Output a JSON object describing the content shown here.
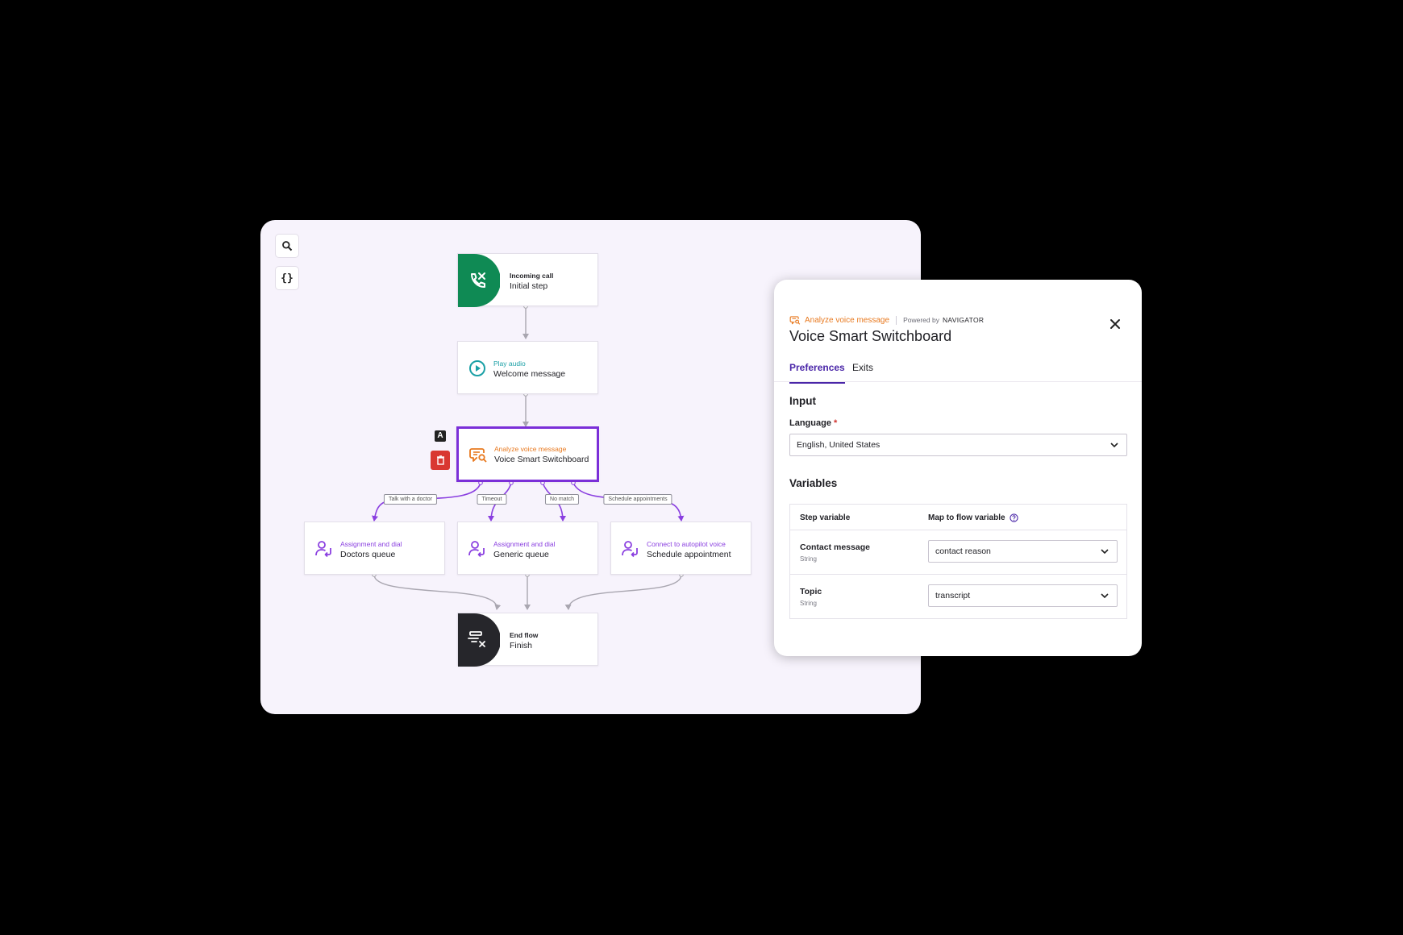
{
  "canvas": {
    "toolbar": {
      "search_icon": "search-icon",
      "variables_label": "{}"
    },
    "nodes": {
      "incoming": {
        "kind": "Incoming call",
        "title": "Initial step",
        "icon": "phone-icon",
        "color": "#0f8a54"
      },
      "play": {
        "kind": "Play audio",
        "title": "Welcome message",
        "icon": "play-circle-icon",
        "color": "#1aa0a6"
      },
      "analyze": {
        "kind": "Analyze voice message",
        "title": "Voice Smart Switchboard",
        "icon": "voice-analyze-icon",
        "color": "#e8791f"
      },
      "doctors": {
        "kind": "Assignment and dial",
        "title": "Doctors queue",
        "icon": "agent-dial-icon",
        "color": "#8a3fe0"
      },
      "generic": {
        "kind": "Assignment and dial",
        "title": "Generic queue",
        "icon": "agent-dial-icon",
        "color": "#8a3fe0"
      },
      "schedule": {
        "kind": "Connect to autopilot voice",
        "title": "Schedule appointment",
        "icon": "agent-dial-icon",
        "color": "#8a3fe0"
      },
      "end": {
        "kind": "End flow",
        "title": "Finish",
        "icon": "end-flow-icon",
        "color": "#26262b"
      }
    },
    "node_actions": {
      "rename_label": "A",
      "delete_icon": "trash-icon"
    },
    "edge_labels": [
      "Talk with a doctor",
      "Timeout",
      "No match",
      "Schedule appointments"
    ]
  },
  "panel": {
    "kind": "Analyze voice message",
    "powered_by": "Powered by",
    "provider": "NAVIGATOR",
    "title": "Voice Smart Switchboard",
    "tabs": [
      "Preferences",
      "Exits"
    ],
    "input_heading": "Input",
    "language_label": "Language",
    "required_mark": "*",
    "language_value": "English, United States",
    "variables_heading": "Variables",
    "table": {
      "headers": [
        "Step variable",
        "Map to flow variable"
      ],
      "rows": [
        {
          "name": "Contact message",
          "type": "String",
          "value": "contact reason"
        },
        {
          "name": "Topic",
          "type": "String",
          "value": "transcript"
        }
      ]
    }
  },
  "colors": {
    "accent": "#4a26a8",
    "selected": "#7b2fd8",
    "branch": "#8a3fe0",
    "orange": "#e8791f"
  }
}
